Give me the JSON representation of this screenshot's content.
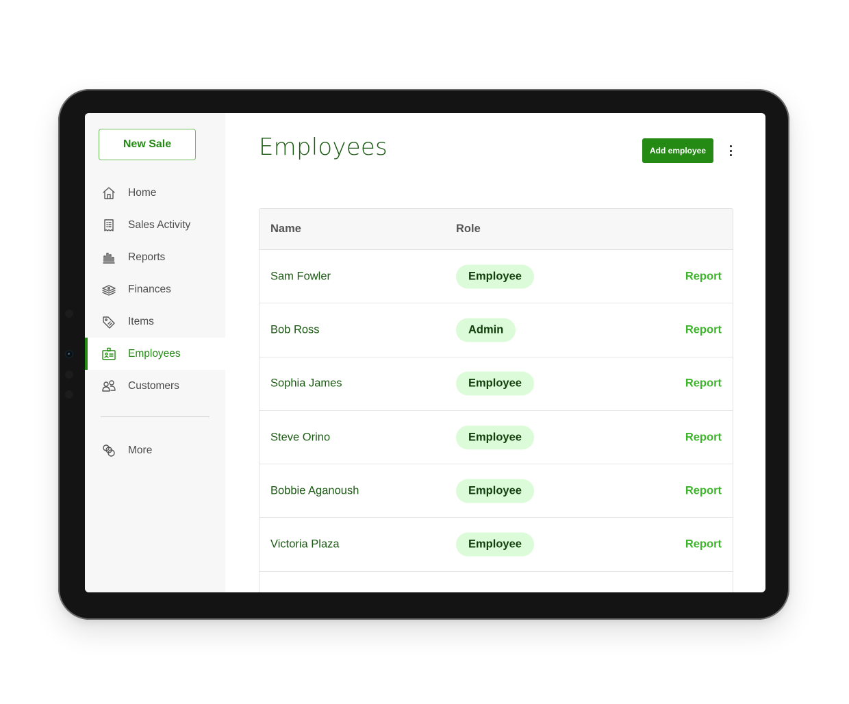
{
  "sidebar": {
    "new_sale_label": "New Sale",
    "items": [
      {
        "label": "Home",
        "icon": "home-icon",
        "active": false
      },
      {
        "label": "Sales Activity",
        "icon": "receipt-icon",
        "active": false
      },
      {
        "label": "Reports",
        "icon": "bar-chart-icon",
        "active": false
      },
      {
        "label": "Finances",
        "icon": "money-stack-icon",
        "active": false
      },
      {
        "label": "Items",
        "icon": "tag-icon",
        "active": false
      },
      {
        "label": "Employees",
        "icon": "id-badge-icon",
        "active": true
      },
      {
        "label": "Customers",
        "icon": "users-icon",
        "active": false
      }
    ],
    "more_label": "More",
    "more_icon": "circles-icon"
  },
  "header": {
    "title": "Employees",
    "add_button_label": "Add employee",
    "menu_icon": "kebab-menu-icon"
  },
  "table": {
    "columns": [
      "Name",
      "Role"
    ],
    "rows": [
      {
        "name": "Sam Fowler",
        "role": "Employee",
        "action": "Report"
      },
      {
        "name": "Bob Ross",
        "role": "Admin",
        "action": "Report"
      },
      {
        "name": "Sophia James",
        "role": "Employee",
        "action": "Report"
      },
      {
        "name": "Steve Orino",
        "role": "Employee",
        "action": "Report"
      },
      {
        "name": "Bobbie Aganoush",
        "role": "Employee",
        "action": "Report"
      },
      {
        "name": "Victoria Plaza",
        "role": "Employee",
        "action": "Report"
      },
      {
        "name": "",
        "role": "",
        "action": ""
      }
    ]
  },
  "colors": {
    "brand_green": "#248a14",
    "title_green": "#1a5a12",
    "link_green": "#3db52a",
    "badge_bg": "#dcfbd8"
  }
}
